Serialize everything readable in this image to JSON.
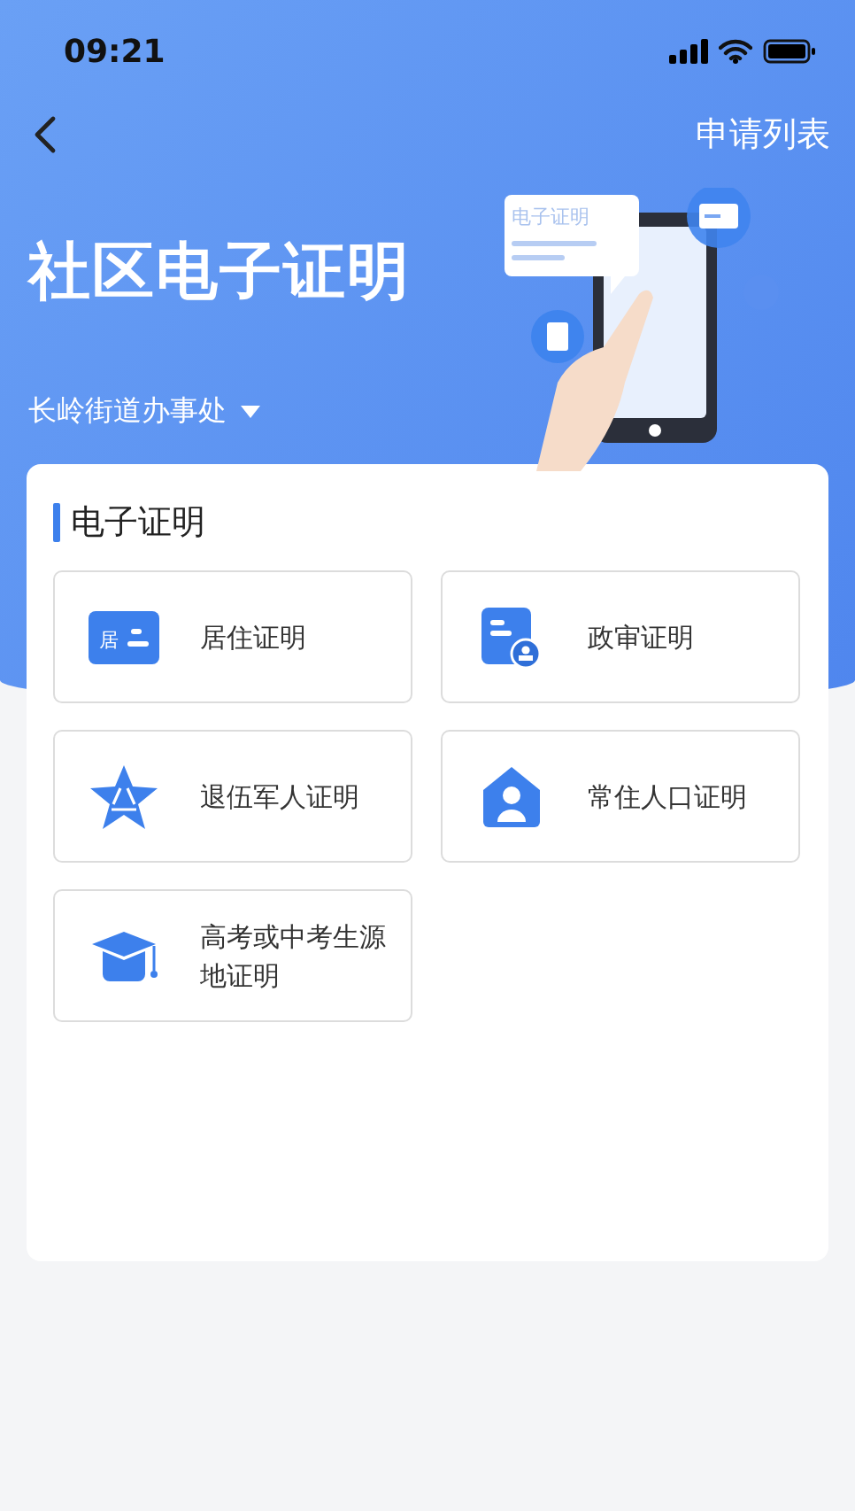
{
  "status_bar": {
    "time": "09:21"
  },
  "nav": {
    "action": "申请列表"
  },
  "header": {
    "title": "社区电子证明",
    "office": "长岭街道办事处",
    "illustration_label": "电子证明"
  },
  "section": {
    "title": "电子证明",
    "items": [
      {
        "label": "居住证明",
        "kind": "residence",
        "icon_text": "居"
      },
      {
        "label": "政审证明",
        "kind": "review"
      },
      {
        "label": "退伍军人证明",
        "kind": "veteran"
      },
      {
        "label": "常住人口证明",
        "kind": "household"
      },
      {
        "label": "高考或中考生源地证明",
        "kind": "exam"
      }
    ]
  }
}
